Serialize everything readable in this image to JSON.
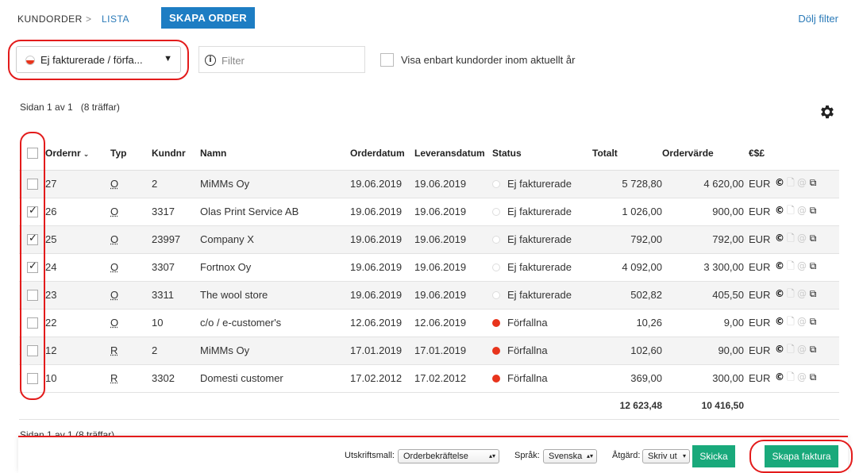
{
  "breadcrumb": {
    "root": "KUNDORDER",
    "separator": ">",
    "current": "LISTA"
  },
  "header": {
    "create_order_label": "SKAPA ORDER",
    "hide_filter_label": "Dölj filter"
  },
  "filters": {
    "status_value": "Ej fakturerade / förfa...",
    "status_caret": "▼",
    "search_placeholder": "Filter",
    "search_info_icon": "i",
    "current_year_label": "Visa enbart kundorder inom aktuellt år",
    "current_year_checked": false
  },
  "pagination": {
    "text": "Sidan 1 av 1",
    "hits": "(8 träffar)"
  },
  "table": {
    "columns": {
      "ordernr": "Ordernr",
      "typ": "Typ",
      "kundnr": "Kundnr",
      "namn": "Namn",
      "orderdatum": "Orderdatum",
      "leveransdatum": "Leveransdatum",
      "status": "Status",
      "totalt": "Totalt",
      "ordervarde": "Ordervärde",
      "currency": "€$£"
    },
    "rows": [
      {
        "checked": false,
        "ordernr": "27",
        "typ": "O",
        "kundnr": "2",
        "namn": "MiMMs Oy",
        "orderdatum": "19.06.2019",
        "leveransdatum": "19.06.2019",
        "status": "Ej fakturerade",
        "status_kind": "open",
        "totalt": "5 728,80",
        "ordervarde": "4 620,00",
        "currency": "EUR"
      },
      {
        "checked": true,
        "ordernr": "26",
        "typ": "O",
        "kundnr": "3317",
        "namn": "Olas Print Service AB",
        "orderdatum": "19.06.2019",
        "leveransdatum": "19.06.2019",
        "status": "Ej fakturerade",
        "status_kind": "open",
        "totalt": "1 026,00",
        "ordervarde": "900,00",
        "currency": "EUR"
      },
      {
        "checked": true,
        "ordernr": "25",
        "typ": "O",
        "kundnr": "23997",
        "namn": "Company X",
        "orderdatum": "19.06.2019",
        "leveransdatum": "19.06.2019",
        "status": "Ej fakturerade",
        "status_kind": "open",
        "totalt": "792,00",
        "ordervarde": "792,00",
        "currency": "EUR"
      },
      {
        "checked": true,
        "ordernr": "24",
        "typ": "O",
        "kundnr": "3307",
        "namn": "Fortnox Oy",
        "orderdatum": "19.06.2019",
        "leveransdatum": "19.06.2019",
        "status": "Ej fakturerade",
        "status_kind": "open",
        "totalt": "4 092,00",
        "ordervarde": "3 300,00",
        "currency": "EUR"
      },
      {
        "checked": false,
        "ordernr": "23",
        "typ": "O",
        "kundnr": "3311",
        "namn": "The wool store",
        "orderdatum": "19.06.2019",
        "leveransdatum": "19.06.2019",
        "status": "Ej fakturerade",
        "status_kind": "open",
        "totalt": "502,82",
        "ordervarde": "405,50",
        "currency": "EUR"
      },
      {
        "checked": false,
        "ordernr": "22",
        "typ": "O",
        "kundnr": "10",
        "namn": "c/o / e-customer's",
        "orderdatum": "12.06.2019",
        "leveransdatum": "12.06.2019",
        "status": "Förfallna",
        "status_kind": "late",
        "totalt": "10,26",
        "ordervarde": "9,00",
        "currency": "EUR"
      },
      {
        "checked": false,
        "ordernr": "12",
        "typ": "R",
        "kundnr": "2",
        "namn": "MiMMs Oy",
        "orderdatum": "17.01.2019",
        "leveransdatum": "17.01.2019",
        "status": "Förfallna",
        "status_kind": "late",
        "totalt": "102,60",
        "ordervarde": "90,00",
        "currency": "EUR"
      },
      {
        "checked": false,
        "ordernr": "10",
        "typ": "R",
        "kundnr": "3302",
        "namn": "Domesti customer",
        "orderdatum": "17.02.2012",
        "leveransdatum": "17.02.2012",
        "status": "Förfallna",
        "status_kind": "late",
        "totalt": "369,00",
        "ordervarde": "300,00",
        "currency": "EUR"
      }
    ],
    "totals": {
      "totalt": "12 623,48",
      "ordervarde": "10 416,50"
    },
    "row_action_icons": [
      "copyright-icon",
      "document-icon",
      "at-icon",
      "copy-icon"
    ]
  },
  "footer": {
    "ghost_text": "Sidan 1 av 1   (8 träffar)",
    "template_label": "Utskriftsmall:",
    "template_value": "Orderbekräftelse",
    "language_label": "Språk:",
    "language_value": "Svenska",
    "action_label": "Åtgärd:",
    "action_value": "Skriv ut",
    "send_label": "Skicka",
    "create_invoice_label": "Skapa faktura"
  },
  "colors": {
    "brand_blue": "#1d7dc3",
    "link_blue": "#2a7ab8",
    "action_green": "#19a97b",
    "overdue_red": "#e8341c",
    "annotation_red": "#e31b1b"
  }
}
